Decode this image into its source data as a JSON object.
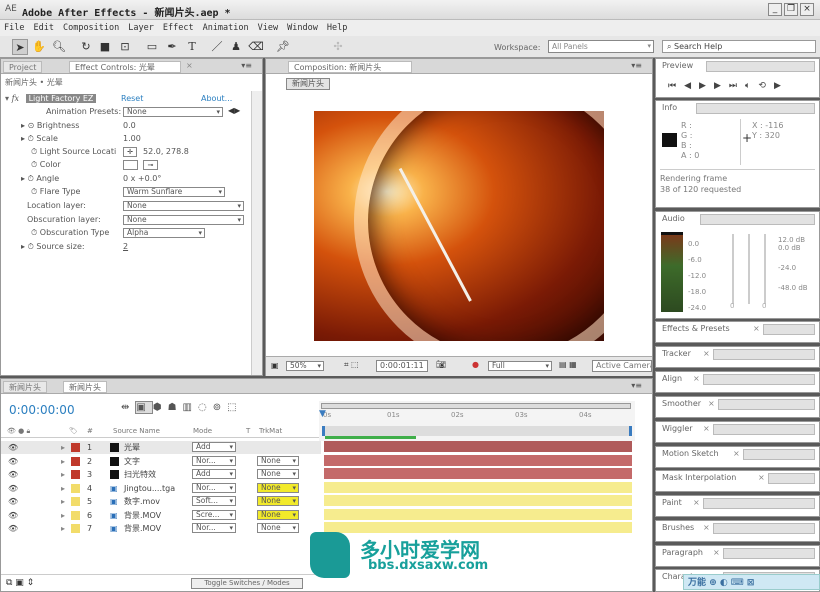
{
  "window": {
    "title": "Adobe After Effects - 新闻片头.aep *"
  },
  "menu": [
    "File",
    "Edit",
    "Composition",
    "Layer",
    "Effect",
    "Animation",
    "View",
    "Window",
    "Help"
  ],
  "toolbar": {
    "workspace_label": "Workspace:",
    "workspace_value": "All Panels",
    "search_placeholder": "Search Help"
  },
  "effect_controls": {
    "tabs": [
      "Project",
      "Effect Controls: 光晕"
    ],
    "breadcrumb": "新闻片头 • 光晕",
    "effect_name": "Light Factory EZ",
    "reset": "Reset",
    "about": "About...",
    "presets_label": "Animation Presets:",
    "presets_value": "None",
    "props": [
      {
        "label": "Brightness",
        "value": "0.0"
      },
      {
        "label": "Scale",
        "value": "1.00"
      },
      {
        "label": "Light Source Locati",
        "value": "52.0, 278.8"
      },
      {
        "label": "Color",
        "value": ""
      },
      {
        "label": "Angle",
        "value": "0 x +0.0°"
      },
      {
        "label": "Flare Type",
        "value": "Warm Sunflare"
      },
      {
        "label": "Location layer:",
        "value": "None"
      },
      {
        "label": "Obscuration layer:",
        "value": "None"
      },
      {
        "label": "Obscuration Type",
        "value": "Alpha"
      },
      {
        "label": "Source size:",
        "value": "2"
      }
    ]
  },
  "composition": {
    "tab": "Composition: 新闻片头",
    "comp_button": "新闻片头",
    "zoom": "50%",
    "timecode": "0:00:01:11",
    "resolution": "Full",
    "camera": "Active Camera"
  },
  "preview": {
    "title": "Preview"
  },
  "info": {
    "title": "Info",
    "r": "R :",
    "g": "G :",
    "b": "B :",
    "a": "A : 0",
    "x": "X : -116",
    "y": "Y : 320",
    "status1": "Rendering frame",
    "status2": "38 of 120 requested"
  },
  "audio": {
    "title": "Audio",
    "left_scale": [
      "0.0",
      "-6.0",
      "-12.0",
      "-18.0",
      "-24.0"
    ],
    "right_scale": [
      "12.0 dB",
      "0.0 dB",
      "-24.0",
      "-48.0 dB"
    ],
    "values": [
      "0",
      "0"
    ]
  },
  "right_panels": [
    "Effects & Presets",
    "Tracker",
    "Align",
    "Smoother",
    "Wiggler",
    "Motion Sketch",
    "Mask Interpolation",
    "Paint",
    "Brushes",
    "Paragraph",
    "Character"
  ],
  "timeline": {
    "tabs": [
      "新闻片头",
      "新闻片头"
    ],
    "timecode": "0:00:00:00",
    "columns": {
      "num": "#",
      "source": "Source Name",
      "mode": "Mode",
      "t": "T",
      "trkmat": "TrkMat"
    },
    "ruler": [
      "0s",
      "01s",
      "02s",
      "03s",
      "04s"
    ],
    "toggle": "Toggle Switches / Modes",
    "layers": [
      {
        "num": "1",
        "name": "光晕",
        "mode": "Add",
        "trkmat": "",
        "label_color": "#c0392b",
        "bar_color": "#b05a5a"
      },
      {
        "num": "2",
        "name": "文字",
        "mode": "Nor...",
        "trkmat": "None",
        "label_color": "#c0392b",
        "bar_color": "#c46a6a"
      },
      {
        "num": "3",
        "name": "扫光特效",
        "mode": "Add",
        "trkmat": "None",
        "label_color": "#c0392b",
        "bar_color": "#c46a6a"
      },
      {
        "num": "4",
        "name": "Jingtou....tga",
        "mode": "Nor...",
        "trkmat": "None",
        "label_color": "#f2dc6a",
        "bar_color": "#f6ec8e"
      },
      {
        "num": "5",
        "name": "数字.mov",
        "mode": "Soft...",
        "trkmat": "None",
        "label_color": "#f2dc6a",
        "bar_color": "#f6ec8e"
      },
      {
        "num": "6",
        "name": "背景.MOV",
        "mode": "Scre...",
        "trkmat": "None",
        "label_color": "#f2dc6a",
        "bar_color": "#f6ec8e"
      },
      {
        "num": "7",
        "name": "背景.MOV",
        "mode": "Nor...",
        "trkmat": "None",
        "label_color": "#f2dc6a",
        "bar_color": "#f6ec8e"
      }
    ],
    "work_area_rendered_fraction": 0.3
  },
  "watermark": {
    "logo": "多小时爱学网",
    "url": "bbs.dxsaxw.com"
  },
  "taskbar": {
    "ime": "万能"
  }
}
